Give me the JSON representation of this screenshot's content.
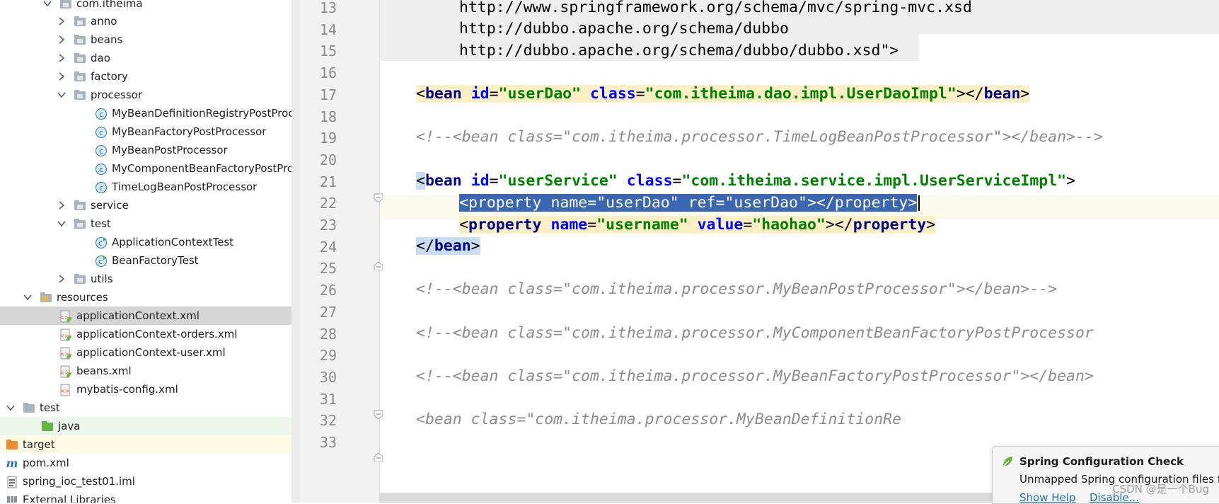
{
  "project_tree": {
    "items": [
      {
        "label": "com.itheima",
        "icon": "package-icon"
      },
      {
        "label": "anno",
        "icon": "package-icon"
      },
      {
        "label": "beans",
        "icon": "package-icon"
      },
      {
        "label": "dao",
        "icon": "package-icon"
      },
      {
        "label": "factory",
        "icon": "package-icon"
      },
      {
        "label": "processor",
        "icon": "package-icon"
      },
      {
        "label": "MyBeanDefinitionRegistryPostProces",
        "icon": "class-icon"
      },
      {
        "label": "MyBeanFactoryPostProcessor",
        "icon": "class-icon"
      },
      {
        "label": "MyBeanPostProcessor",
        "icon": "class-icon"
      },
      {
        "label": "MyComponentBeanFactoryPostProce",
        "icon": "class-icon"
      },
      {
        "label": "TimeLogBeanPostProcessor",
        "icon": "class-icon"
      },
      {
        "label": "service",
        "icon": "package-icon"
      },
      {
        "label": "test",
        "icon": "package-icon"
      },
      {
        "label": "ApplicationContextTest",
        "icon": "test-class-icon"
      },
      {
        "label": "BeanFactoryTest",
        "icon": "test-class-icon"
      },
      {
        "label": "utils",
        "icon": "package-icon"
      },
      {
        "label": "resources",
        "icon": "resources-folder-icon"
      },
      {
        "label": "applicationContext.xml",
        "icon": "spring-xml-icon"
      },
      {
        "label": "applicationContext-orders.xml",
        "icon": "spring-xml-icon"
      },
      {
        "label": "applicationContext-user.xml",
        "icon": "spring-xml-icon"
      },
      {
        "label": "beans.xml",
        "icon": "spring-xml-icon"
      },
      {
        "label": "mybatis-config.xml",
        "icon": "xml-icon"
      },
      {
        "label": "test",
        "icon": "folder-icon"
      },
      {
        "label": "java",
        "icon": "test-source-folder-icon"
      },
      {
        "label": "target",
        "icon": "excluded-folder-icon"
      },
      {
        "label": "pom.xml",
        "icon": "maven-icon"
      },
      {
        "label": "spring_ioc_test01.iml",
        "icon": "iml-icon"
      },
      {
        "label": "External Libraries",
        "icon": "library-icon"
      }
    ],
    "selected": "applicationContext.xml"
  },
  "editor": {
    "line_numbers": [
      "13",
      "14",
      "15",
      "16",
      "17",
      "18",
      "19",
      "20",
      "21",
      "22",
      "23",
      "24",
      "25",
      "26",
      "27",
      "28",
      "29",
      "30",
      "31",
      "32",
      "33"
    ],
    "lines": {
      "l13_url": "http://www.springframework.org/schema/mvc/spring-mvc.xsd",
      "l14_url": "http://dubbo.apache.org/schema/dubbo",
      "l15_url": "http://dubbo.apache.org/schema/dubbo/dubbo.xsd",
      "l15_end": "\">",
      "l17": {
        "open": "<",
        "tag": "bean",
        "attr1": "id",
        "eq1": "=",
        "val1": "\"userDao\"",
        "attr2": "class",
        "eq2": "=",
        "val2": "\"com.itheima.dao.impl.UserDaoImpl\"",
        "close": "></",
        "tag2": "bean",
        "end": ">"
      },
      "l19": "<!--<bean class=\"com.itheima.processor.TimeLogBeanPostProcessor\"></bean>-->",
      "l21": {
        "open": "<",
        "tag": "bean",
        "attr1": "id",
        "eq1": "=",
        "val1": "\"userService\"",
        "attr2": "class",
        "eq2": "=",
        "val2": "\"com.itheima.service.impl.UserServiceImpl\"",
        "end": ">"
      },
      "l22": {
        "open": "<",
        "tag": "property",
        "attr1": "name",
        "eq1": "=",
        "val1": "\"userDao\"",
        "attr2": "ref",
        "eq2": "=",
        "val2": "\"userDao\"",
        "close": "></",
        "tag2": "property",
        "end": ">"
      },
      "l23": {
        "open": "<",
        "tag": "property",
        "attr1": "name",
        "eq1": "=",
        "val1": "\"username\"",
        "attr2": "value",
        "eq2": "=",
        "val2": "\"haohao\"",
        "close": "></",
        "tag2": "property",
        "end": ">"
      },
      "l24": {
        "open": "</",
        "tag": "bean",
        "end": ">"
      },
      "l26": "<!--<bean class=\"com.itheima.processor.MyBeanPostProcessor\"></bean>-->",
      "l28": "<!--<bean class=\"com.itheima.processor.MyComponentBeanFactoryPostProcessor",
      "l30": "<!--<bean class=\"com.itheima.processor.MyBeanFactoryPostProcessor\"></bean>",
      "l32": "<bean class=\"com.itheima.processor.MyBeanDefinitionRe"
    }
  },
  "notification": {
    "title": "Spring Configuration Check",
    "body": "Unmapped Spring configuration files fo",
    "action_show_help": "Show Help",
    "action_disable": "Disable...",
    "icon": "spring-leaf-icon"
  },
  "watermark": "CSDN @是一个Bug",
  "colors": {
    "tag": "#000080",
    "attribute": "#0000ff",
    "value": "#008000",
    "comment": "#8c8c8c",
    "selection": "#3b67b2",
    "tree_selection": "#d5d5d5"
  }
}
